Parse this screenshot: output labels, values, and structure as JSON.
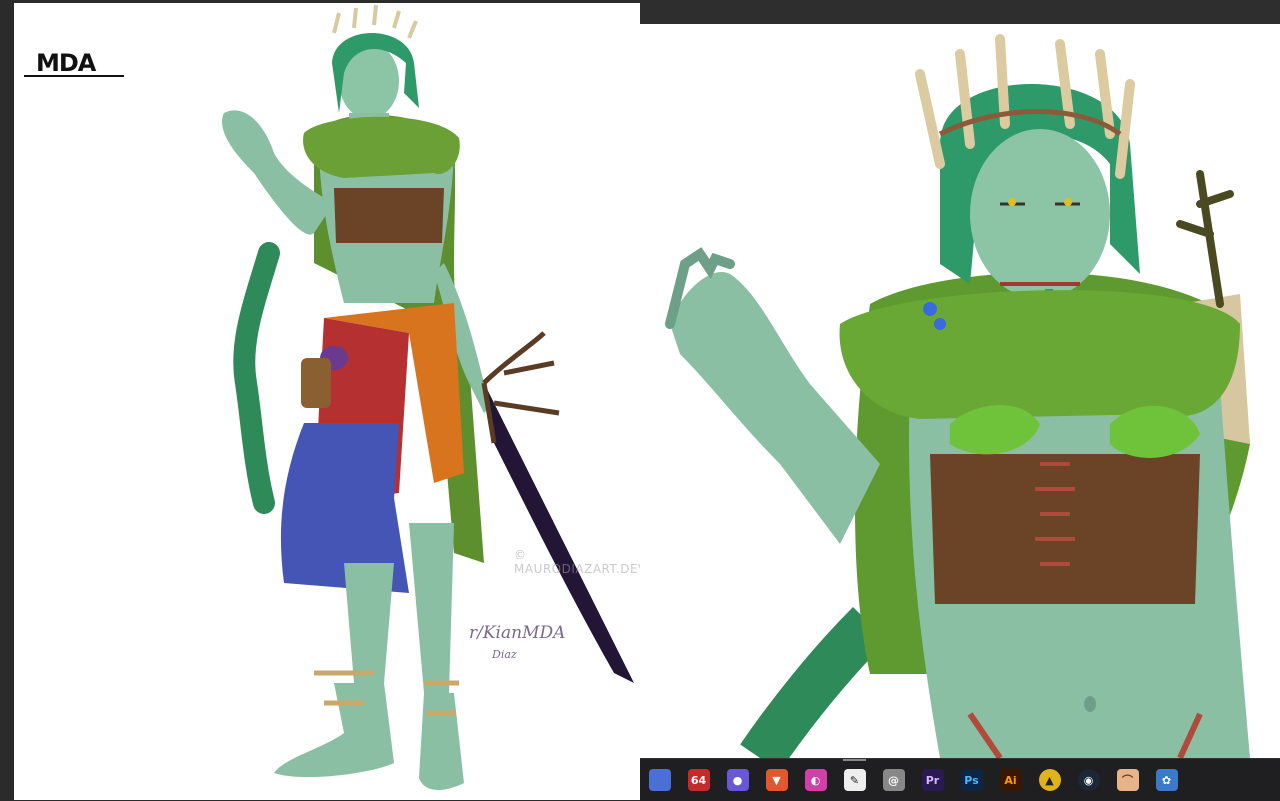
{
  "left_panel": {
    "logo": "MDA",
    "signature_main": "r/KianMDA",
    "signature_sub": "Diaz",
    "watermark": "© MAURODIAZART.DEVIANTART.COM"
  },
  "right_panel": {
    "artwork": "zoomed-character-detail"
  },
  "taskbar": {
    "items": [
      {
        "name": "app-icon-1",
        "glyph": "",
        "color": "#4a6fd6"
      },
      {
        "name": "app-64",
        "glyph": "64",
        "color": "#c62b2b"
      },
      {
        "name": "app-discord",
        "glyph": "●",
        "color": "#6a56d9"
      },
      {
        "name": "app-brave",
        "glyph": "▼",
        "color": "#e2572c"
      },
      {
        "name": "app-color-wheel",
        "glyph": "◐",
        "color": "#d13fa8"
      },
      {
        "name": "app-clip-studio",
        "glyph": "✎",
        "color": "#eeeeee"
      },
      {
        "name": "app-spiral",
        "glyph": "@",
        "color": "#888888"
      },
      {
        "name": "app-premiere",
        "glyph": "Pr",
        "color": "#2a1a52"
      },
      {
        "name": "app-photoshop",
        "glyph": "Ps",
        "color": "#0b2744"
      },
      {
        "name": "app-illustrator",
        "glyph": "Ai",
        "color": "#3a1800"
      },
      {
        "name": "app-triangle",
        "glyph": "▲",
        "color": "#e0b21c"
      },
      {
        "name": "app-steam",
        "glyph": "◉",
        "color": "#1b2838"
      },
      {
        "name": "app-hat",
        "glyph": "⌒",
        "color": "#e7b48a"
      },
      {
        "name": "app-paint",
        "glyph": "✿",
        "color": "#3a7ac9"
      }
    ]
  }
}
